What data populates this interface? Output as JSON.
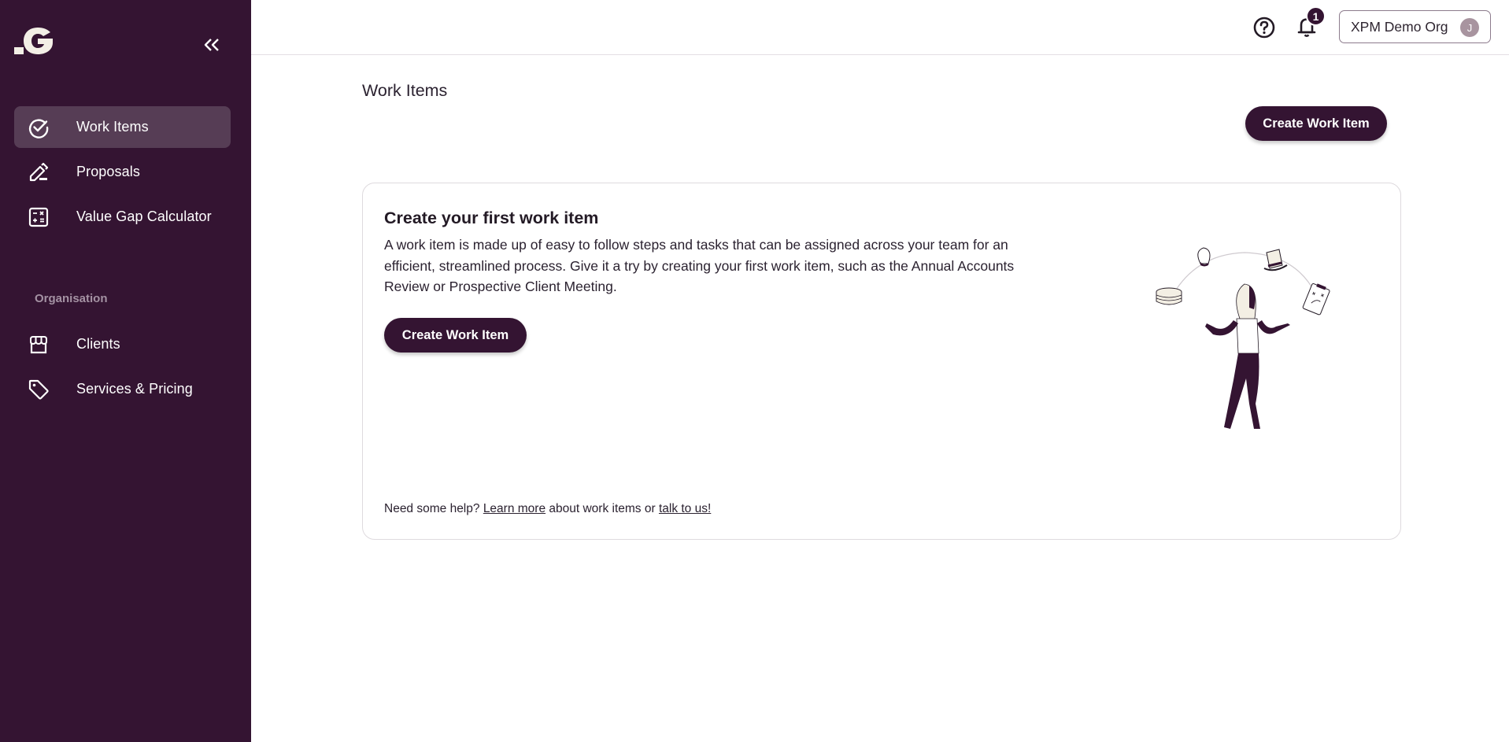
{
  "brand": {
    "logo_text": "G",
    "colors": {
      "primary": "#341432",
      "active_nav": "#563d55",
      "section_label": "#a492a3",
      "border": "#dedade"
    }
  },
  "sidebar": {
    "collapse_icon": "chevrons-left-icon",
    "items": [
      {
        "label": "Work Items",
        "icon": "check-circle-icon",
        "active": true
      },
      {
        "label": "Proposals",
        "icon": "pencil-icon",
        "active": false
      },
      {
        "label": "Value Gap Calculator",
        "icon": "calculator-icon",
        "active": false
      }
    ],
    "section_label": "Organisation",
    "org_items": [
      {
        "label": "Clients",
        "icon": "store-icon",
        "active": false
      },
      {
        "label": "Services & Pricing",
        "icon": "tag-icon",
        "active": false
      }
    ]
  },
  "topbar": {
    "help_icon": "help-circle-icon",
    "bell_icon": "bell-icon",
    "notification_count": "1",
    "org_name": "XPM Demo Org",
    "avatar_initial": "J"
  },
  "main": {
    "title": "Work Items",
    "create_button": "Create Work Item",
    "empty_state": {
      "title": "Create your first work item",
      "description": "A work item is made up of easy to follow steps and tasks that can be assigned across your team for an efficient, streamlined process. Give it a try by creating your first work item, such as the Annual Accounts Review or Prospective Client Meeting.",
      "button": "Create Work Item",
      "help_prefix": "Need some help?",
      "learn_more": "Learn more",
      "help_middle": "about work items or",
      "talk_link": "talk to us!",
      "illustration": "juggling-person-illustration"
    }
  }
}
